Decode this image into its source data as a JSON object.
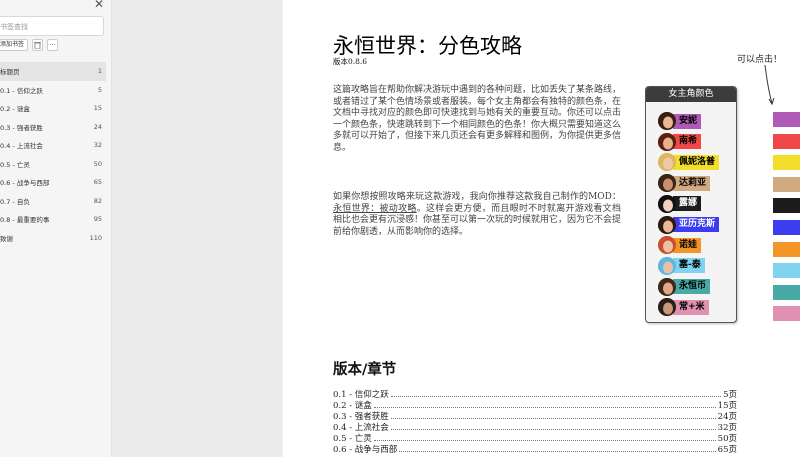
{
  "sidebar": {
    "search_placeholder": "书签查找",
    "add_bookmark_label": "添加书签",
    "items": [
      {
        "label": "标题页",
        "page": "1"
      },
      {
        "label": "0.1 - 信仰之跃",
        "page": "5"
      },
      {
        "label": "0.2 - 谜盒",
        "page": "15"
      },
      {
        "label": "0.3 - 强者获胜",
        "page": "24"
      },
      {
        "label": "0.4 - 上流社会",
        "page": "32"
      },
      {
        "label": "0.5 - 亡灵",
        "page": "50"
      },
      {
        "label": "0.6 - 战争与西部",
        "page": "65"
      },
      {
        "label": "0.7 - 自负",
        "page": "82"
      },
      {
        "label": "0.8 - 最重要的事",
        "page": "95"
      },
      {
        "label": "致谢",
        "page": "110"
      }
    ]
  },
  "page": {
    "title": "永恒世界：分色攻略",
    "version": "版本0.8.6",
    "intro": "这篇攻略旨在帮助你解决游玩中遇到的各种问题，比如丢失了某条路线，或者错过了某个色情场景或者服装。每个女主角都会有独特的颜色条，在文档中寻找对应的颜色即可快速找到与她有关的重要互动。你还可以点击一个颜色条，快速跳转到下一个相同颜色的色条！你大概只需要知道这么多就可以开始了，但接下来几页还会有更多解释和图例，为你提供更多信息。",
    "mod_before": "如果你想按照攻略来玩这款游戏，我向你推荐这款我自己制作的MOD：",
    "mod_link": "永恒世界：被动攻略",
    "mod_after": "。这样会更方便，而且眼时不时就离开游戏看文档相比也会更有沉浸感！你甚至可以第一次玩的时候就用它，因为它不会提前给你剧透，从而影响你的选择。",
    "panel_title": "女主角颜色",
    "click_hint": "可以点击！",
    "toc_heading": "版本/章节",
    "toc": [
      {
        "label": "0.1 - 信仰之跃",
        "page": "5页"
      },
      {
        "label": "0.2 - 谜盒",
        "page": "15页"
      },
      {
        "label": "0.3 - 强者获胜",
        "page": "24页"
      },
      {
        "label": "0.4 - 上流社会",
        "page": "32页"
      },
      {
        "label": "0.5 - 亡灵",
        "page": "50页"
      },
      {
        "label": "0.6 - 战争与西部",
        "page": "65页"
      }
    ]
  },
  "characters": [
    {
      "name": "安妮",
      "color": "#b05ab8",
      "text_color": "#000000",
      "hair": "#3b1e10",
      "skin": "#e8b896"
    },
    {
      "name": "南希",
      "color": "#f04848",
      "text_color": "#000000",
      "hair": "#5a2010",
      "skin": "#e8b090"
    },
    {
      "name": "佩妮洛普",
      "color": "#f2de2a",
      "text_color": "#000000",
      "hair": "#d9b860",
      "skin": "#f0c8a8"
    },
    {
      "name": "达莉亚",
      "color": "#d2aa80",
      "text_color": "#000000",
      "hair": "#3a2414",
      "skin": "#c89070"
    },
    {
      "name": "露娜",
      "color": "#1c1c1c",
      "text_color": "#ffffff",
      "hair": "#101010",
      "skin": "#f0d0c0"
    },
    {
      "name": "亚历克斯",
      "color": "#3c3cf0",
      "text_color": "#ffffff",
      "hair": "#2a1a12",
      "skin": "#e8b898"
    },
    {
      "name": "诺娃",
      "color": "#f29628",
      "text_color": "#000000",
      "hair": "#c85030",
      "skin": "#f0c0a0"
    },
    {
      "name": "塞-泰",
      "color": "#80d4f0",
      "text_color": "#000000",
      "hair": "#60b8e0",
      "skin": "#e8c0a8"
    },
    {
      "name": "永恒币",
      "color": "#48aaa6",
      "text_color": "#000000",
      "hair": "#402818",
      "skin": "#e0a888"
    },
    {
      "name": "常+米",
      "color": "#e090b0",
      "text_color": "#000000",
      "hair": "#282018",
      "skin": "#c89878"
    }
  ]
}
